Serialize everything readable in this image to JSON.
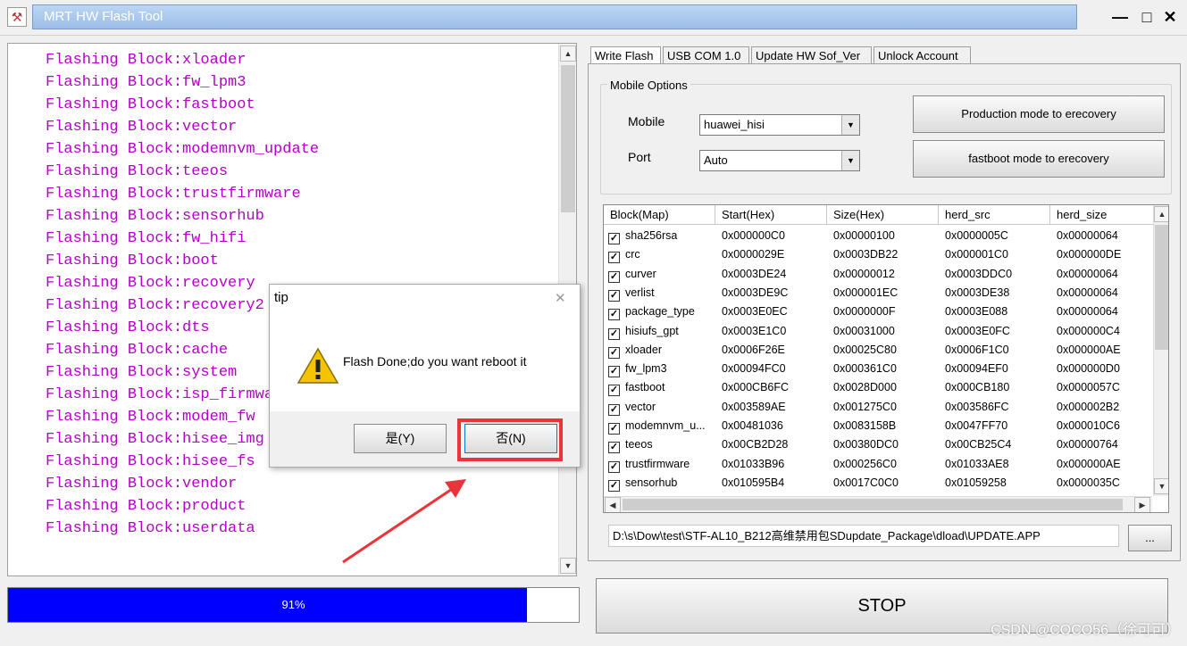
{
  "window": {
    "title": "MRT HW Flash Tool",
    "minimize": "—",
    "maximize": "□",
    "close": "✕"
  },
  "log": {
    "lines": [
      "Flashing Block:xloader",
      "Flashing Block:fw_lpm3",
      "Flashing Block:fastboot",
      "Flashing Block:vector",
      "Flashing Block:modemnvm_update",
      "Flashing Block:teeos",
      "Flashing Block:trustfirmware",
      "Flashing Block:sensorhub",
      "Flashing Block:fw_hifi",
      "Flashing Block:boot",
      "Flashing Block:recovery",
      "Flashing Block:recovery2",
      "Flashing Block:dts",
      "Flashing Block:cache",
      "Flashing Block:system",
      "Flashing Block:isp_firmwa",
      "Flashing Block:modem_fw",
      "Flashing Block:hisee_img",
      "Flashing Block:hisee_fs",
      "Flashing Block:vendor",
      "Flashing Block:product",
      "Flashing Block:userdata"
    ],
    "text_color": "#b400c8"
  },
  "progress": {
    "label": "91%",
    "fraction": 0.91,
    "color": "#0000fe"
  },
  "tabs": [
    "Write Flash",
    "USB COM 1.0",
    "Update HW Sof_Ver",
    "Unlock Account"
  ],
  "mobile_options": {
    "title": "Mobile Options",
    "mobile_label": "Mobile",
    "mobile_value": "huawei_hisi",
    "port_label": "Port",
    "port_value": "Auto",
    "production_button": "Production mode to erecovery",
    "fastboot_button": "fastboot mode to erecovery"
  },
  "table": {
    "headers": [
      "Block(Map)",
      "Start(Hex)",
      "Size(Hex)",
      "herd_src",
      "herd_size"
    ],
    "rows": [
      [
        "sha256rsa",
        "0x000000C0",
        "0x00000100",
        "0x0000005C",
        "0x00000064"
      ],
      [
        "crc",
        "0x0000029E",
        "0x0003DB22",
        "0x000001C0",
        "0x000000DE"
      ],
      [
        "curver",
        "0x0003DE24",
        "0x00000012",
        "0x0003DDC0",
        "0x00000064"
      ],
      [
        "verlist",
        "0x0003DE9C",
        "0x000001EC",
        "0x0003DE38",
        "0x00000064"
      ],
      [
        "package_type",
        "0x0003E0EC",
        "0x0000000F",
        "0x0003E088",
        "0x00000064"
      ],
      [
        "hisiufs_gpt",
        "0x0003E1C0",
        "0x00031000",
        "0x0003E0FC",
        "0x000000C4"
      ],
      [
        "xloader",
        "0x0006F26E",
        "0x00025C80",
        "0x0006F1C0",
        "0x000000AE"
      ],
      [
        "fw_lpm3",
        "0x00094FC0",
        "0x000361C0",
        "0x00094EF0",
        "0x000000D0"
      ],
      [
        "fastboot",
        "0x000CB6FC",
        "0x0028D000",
        "0x000CB180",
        "0x0000057C"
      ],
      [
        "vector",
        "0x003589AE",
        "0x001275C0",
        "0x003586FC",
        "0x000002B2"
      ],
      [
        "modemnvm_u...",
        "0x00481036",
        "0x0083158B",
        "0x0047FF70",
        "0x000010C6"
      ],
      [
        "teeos",
        "0x00CB2D28",
        "0x00380DC0",
        "0x00CB25C4",
        "0x00000764"
      ],
      [
        "trustfirmware",
        "0x01033B96",
        "0x000256C0",
        "0x01033AE8",
        "0x000000AE"
      ],
      [
        "sensorhub",
        "0x010595B4",
        "0x0017C0C0",
        "0x01059258",
        "0x0000035C"
      ]
    ]
  },
  "file_path": "D:\\s\\Dow\\test\\STF-AL10_B212高维禁用包SDupdate_Package\\dload\\UPDATE.APP",
  "browse_button": "...",
  "stop_button": "STOP",
  "dialog": {
    "title": "tip",
    "message": "Flash Done;do you want reboot it",
    "yes_button": "是(Y)",
    "no_button": "否(N)"
  },
  "watermark": "CSDN @COCO56（徐可可）"
}
